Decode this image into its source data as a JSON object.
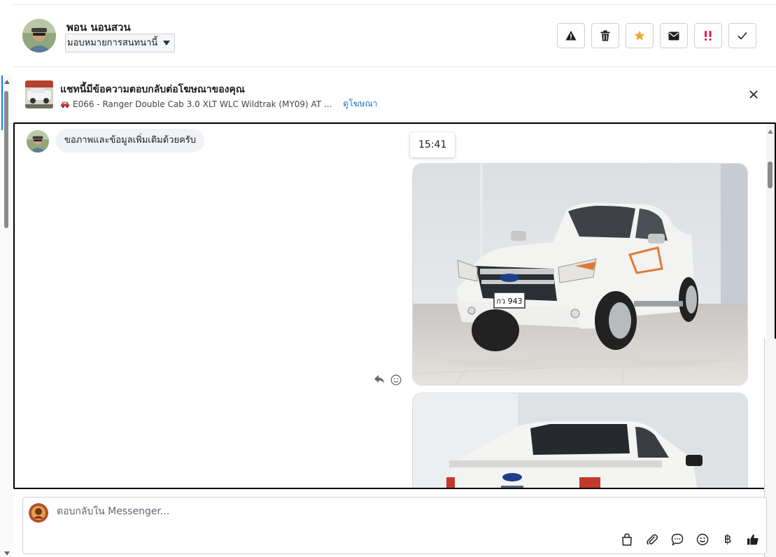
{
  "header": {
    "user_name": "พอน นอนสวน",
    "assign_label": "มอบหมายการสนทนานี้",
    "actions": [
      {
        "name": "report-button",
        "icon": "warning-icon"
      },
      {
        "name": "delete-button",
        "icon": "trash-icon"
      },
      {
        "name": "star-button",
        "icon": "star-icon",
        "color": "#f5a524"
      },
      {
        "name": "mark-unread-button",
        "icon": "envelope-icon"
      },
      {
        "name": "important-button",
        "icon": "double-exclamation-icon",
        "color": "#e41e3f"
      },
      {
        "name": "done-button",
        "icon": "checkmark-icon"
      }
    ]
  },
  "ad_banner": {
    "title": "แชทนี้มีข้อความตอบกลับต่อโฆษณาของคุณ",
    "subtitle": "E066 - Ranger Double Cab 3.0 XLT WLC Wildtrak (MY09) AT ...",
    "link_label": "ดูโฆษณา"
  },
  "chat": {
    "incoming_message": "ขอภาพและข้อมูลเพิ่มเติมด้วยครับ",
    "timestamp": "15:41",
    "plate_text": "กว 943"
  },
  "composer": {
    "placeholder": "ตอบกลับใน Messenger...",
    "tools": [
      {
        "name": "shop-bag-button",
        "icon": "bag-icon"
      },
      {
        "name": "attach-button",
        "icon": "paperclip-icon"
      },
      {
        "name": "saved-reply-button",
        "icon": "speech-bubble-icon"
      },
      {
        "name": "emoji-button",
        "icon": "smiley-icon"
      },
      {
        "name": "payment-button",
        "icon": "baht-icon",
        "label": "฿"
      },
      {
        "name": "like-button",
        "icon": "thumbs-up-icon"
      }
    ]
  },
  "colors": {
    "link": "#1a73c8",
    "star": "#f5a524",
    "important": "#e41e3f"
  }
}
